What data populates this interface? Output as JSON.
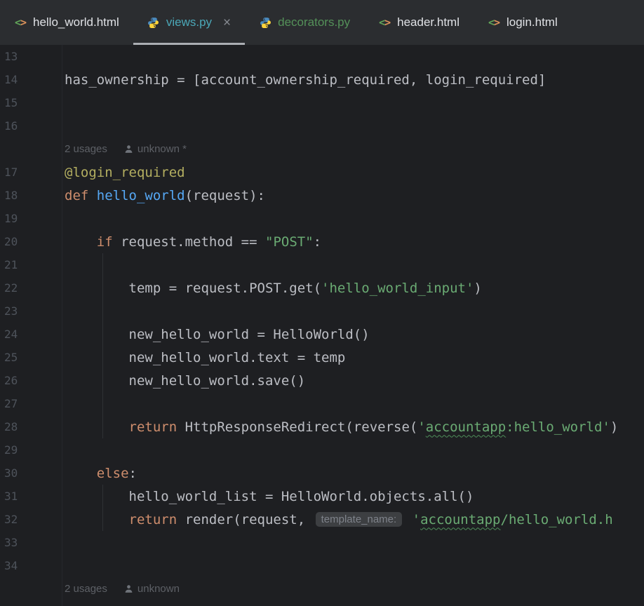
{
  "colors": {
    "editor_bg": "#1E1F22",
    "tabbar_bg": "#2B2D30",
    "default_text": "#BCBEC4",
    "keyword": "#CF8E6D",
    "string": "#6AAB73",
    "decorator": "#B3AE60",
    "function_name": "#56A8F5",
    "line_number": "#4E535B",
    "hint_text": "#5D6066",
    "active_tab_indicator": "#ABAEB3",
    "tab_modified_teal": "#4BA8B8",
    "tab_added_green": "#549159",
    "tab_default": "#DFE1E5",
    "inlay_chip_bg": "#3D3F42",
    "inlay_chip_text": "#7E828A",
    "wavy_underline": "#4E8F5A",
    "python_icon_blue": "#4B8BBE",
    "python_icon_yellow": "#FFD43B",
    "html_icon_left": "#62A559",
    "html_icon_right": "#DE935B"
  },
  "icons": {
    "close_glyph": "×",
    "html_left": "<",
    "html_right": ">"
  },
  "tab_bar": {
    "tabs": [
      {
        "label": "hello_world.html",
        "icon": "html",
        "active": false,
        "closable": false,
        "color_key": "tab_default"
      },
      {
        "label": "views.py",
        "icon": "python",
        "active": true,
        "closable": true,
        "color_key": "tab_modified_teal"
      },
      {
        "label": "decorators.py",
        "icon": "python",
        "active": false,
        "closable": false,
        "color_key": "tab_added_green"
      },
      {
        "label": "header.html",
        "icon": "html",
        "active": false,
        "closable": false,
        "color_key": "tab_default"
      },
      {
        "label": "login.html",
        "icon": "html",
        "active": false,
        "closable": false,
        "color_key": "tab_default"
      }
    ]
  },
  "editor": {
    "lines": [
      {
        "num": 13,
        "segments": []
      },
      {
        "num": 14,
        "segments": [
          {
            "t": "has_ownership = [account_ownership_required, login_required]",
            "c": "default"
          }
        ]
      },
      {
        "num": 15,
        "segments": []
      },
      {
        "num": 16,
        "segments": []
      },
      {
        "hint": true,
        "usages": "2 usages",
        "author": "unknown *"
      },
      {
        "num": 17,
        "segments": [
          {
            "t": "@login_required",
            "c": "decorator"
          }
        ]
      },
      {
        "num": 18,
        "segments": [
          {
            "t": "def ",
            "c": "keyword"
          },
          {
            "t": "hello_world",
            "c": "funcname"
          },
          {
            "t": "(request):",
            "c": "default"
          }
        ]
      },
      {
        "num": 19,
        "segments": []
      },
      {
        "num": 20,
        "segments": [
          {
            "t": "    ",
            "c": "default"
          },
          {
            "t": "if ",
            "c": "keyword"
          },
          {
            "t": "request.method == ",
            "c": "default"
          },
          {
            "t": "\"POST\"",
            "c": "string"
          },
          {
            "t": ":",
            "c": "default"
          }
        ]
      },
      {
        "num": 21,
        "segments": []
      },
      {
        "num": 22,
        "segments": [
          {
            "t": "        temp = request.POST.get(",
            "c": "default"
          },
          {
            "t": "'hello_world_input'",
            "c": "string"
          },
          {
            "t": ")",
            "c": "default"
          }
        ]
      },
      {
        "num": 23,
        "segments": []
      },
      {
        "num": 24,
        "segments": [
          {
            "t": "        new_hello_world = HelloWorld()",
            "c": "default"
          }
        ]
      },
      {
        "num": 25,
        "segments": [
          {
            "t": "        new_hello_world.text = temp",
            "c": "default"
          }
        ]
      },
      {
        "num": 26,
        "segments": [
          {
            "t": "        new_hello_world.save()",
            "c": "default"
          }
        ]
      },
      {
        "num": 27,
        "segments": []
      },
      {
        "num": 28,
        "segments": [
          {
            "t": "        ",
            "c": "default"
          },
          {
            "t": "return ",
            "c": "keyword"
          },
          {
            "t": "HttpResponseRedirect(reverse(",
            "c": "default"
          },
          {
            "t": "'",
            "c": "string"
          },
          {
            "t": "accountapp",
            "c": "string_underline"
          },
          {
            "t": ":hello_world'",
            "c": "string"
          },
          {
            "t": ")",
            "c": "default"
          }
        ]
      },
      {
        "num": 29,
        "segments": []
      },
      {
        "num": 30,
        "segments": [
          {
            "t": "    ",
            "c": "default"
          },
          {
            "t": "else",
            "c": "keyword"
          },
          {
            "t": ":",
            "c": "default"
          }
        ]
      },
      {
        "num": 31,
        "segments": [
          {
            "t": "        hello_world_list = HelloWorld.objects.all()",
            "c": "default"
          }
        ]
      },
      {
        "num": 32,
        "segments": [
          {
            "t": "        ",
            "c": "default"
          },
          {
            "t": "return ",
            "c": "keyword"
          },
          {
            "t": "render(request, ",
            "c": "default"
          },
          {
            "t": "template_name:",
            "c": "param_hint"
          },
          {
            "t": " ",
            "c": "default"
          },
          {
            "t": "'",
            "c": "string"
          },
          {
            "t": "accountapp",
            "c": "string_underline"
          },
          {
            "t": "/hello_world.h",
            "c": "string"
          }
        ]
      },
      {
        "num": 33,
        "segments": []
      },
      {
        "num": 34,
        "segments": []
      },
      {
        "hint": true,
        "usages": "2 usages",
        "author": "unknown"
      }
    ]
  }
}
